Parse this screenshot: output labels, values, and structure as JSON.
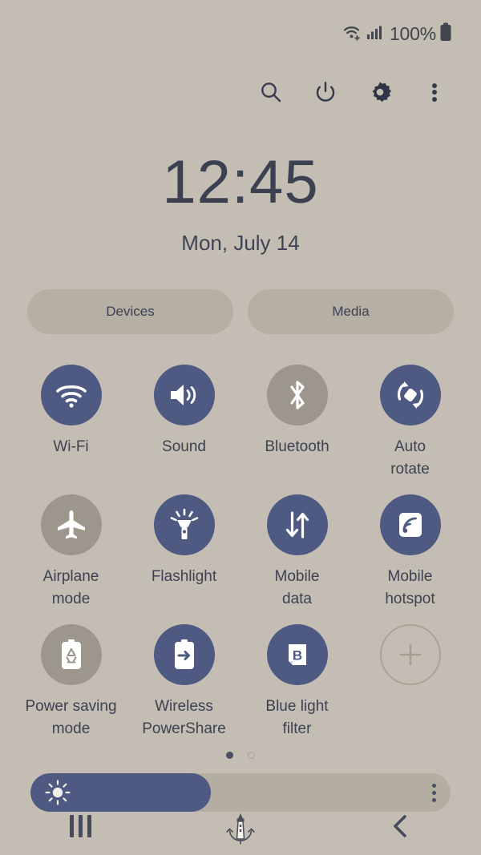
{
  "status_bar": {
    "wifi_icon": "wifi-signal-icon",
    "cellular_icon": "cellular-signal-icon",
    "battery_percent": "100%",
    "battery_icon": "battery-full-icon"
  },
  "header": {
    "icons": [
      {
        "name": "search-icon",
        "label": "Search"
      },
      {
        "name": "power-icon",
        "label": "Power"
      },
      {
        "name": "settings-gear-icon",
        "label": "Settings"
      },
      {
        "name": "overflow-menu-icon",
        "label": "More options"
      }
    ]
  },
  "clock": {
    "time": "12:45",
    "date": "Mon, July 14"
  },
  "pills": [
    {
      "label": "Devices",
      "name": "devices-button"
    },
    {
      "label": "Media",
      "name": "media-button"
    }
  ],
  "tiles": [
    {
      "label": "Wi-Fi",
      "icon": "wifi-icon",
      "active": true
    },
    {
      "label": "Sound",
      "icon": "sound-icon",
      "active": true
    },
    {
      "label": "Bluetooth",
      "icon": "bluetooth-icon",
      "active": false
    },
    {
      "label": "Auto\nrotate",
      "icon": "auto-rotate-icon",
      "active": true
    },
    {
      "label": "Airplane\nmode",
      "icon": "airplane-icon",
      "active": false
    },
    {
      "label": "Flashlight",
      "icon": "flashlight-icon",
      "active": true
    },
    {
      "label": "Mobile\ndata",
      "icon": "mobile-data-icon",
      "active": true
    },
    {
      "label": "Mobile\nhotspot",
      "icon": "mobile-hotspot-icon",
      "active": true
    },
    {
      "label": "Power saving\nmode",
      "icon": "power-saving-icon",
      "active": false
    },
    {
      "label": "Wireless\nPowerShare",
      "icon": "wireless-powershare-icon",
      "active": true
    },
    {
      "label": "Blue light\nfilter",
      "icon": "blue-light-filter-icon",
      "active": true
    },
    {
      "label": "",
      "icon": "add-tile-icon",
      "active": false,
      "add": true
    }
  ],
  "pagination": {
    "total_pages": 2,
    "current_page": 1
  },
  "brightness": {
    "icon": "brightness-sun-icon",
    "value_percent": 43,
    "menu_icon": "brightness-options-icon"
  },
  "nav_bar": {
    "recents": "recents-icon",
    "home": "home-lighthouse-icon",
    "back": "back-icon"
  },
  "colors": {
    "background": "#c3bdb3",
    "tile_active": "#4f5a83",
    "tile_inactive": "#9d968c",
    "pill": "#b5afa4",
    "text": "#3d4252"
  }
}
